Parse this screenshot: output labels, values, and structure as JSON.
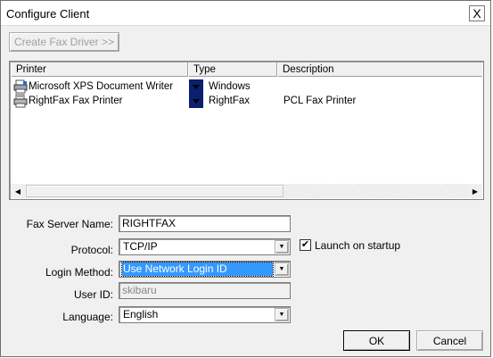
{
  "window": {
    "title": "Configure Client",
    "close_glyph": "X"
  },
  "toolbar": {
    "create_fax_driver_label": "Create Fax Driver >>"
  },
  "printer_list": {
    "columns": [
      "Printer",
      "Type",
      "Description"
    ],
    "rows": [
      {
        "printer": "Microsoft XPS Document Writer",
        "type": "Windows",
        "description": ""
      },
      {
        "printer": "RightFax Fax Printer",
        "type": "RightFax",
        "description": "PCL Fax Printer"
      }
    ]
  },
  "form": {
    "fax_server_name_label": "Fax Server Name:",
    "fax_server_name_value": "RIGHTFAX",
    "protocol_label": "Protocol:",
    "protocol_value": "TCP/IP",
    "launch_on_startup_label": "Launch on startup",
    "launch_on_startup_checked": true,
    "login_method_label": "Login Method:",
    "login_method_value": "Use Network Login ID",
    "user_id_label": "User ID:",
    "user_id_value": "skibaru",
    "language_label": "Language:",
    "language_value": "English"
  },
  "buttons": {
    "ok_label": "OK",
    "cancel_label": "Cancel"
  },
  "colors": {
    "selection": "#3399ff",
    "window_bg": "#f0f0f0"
  }
}
